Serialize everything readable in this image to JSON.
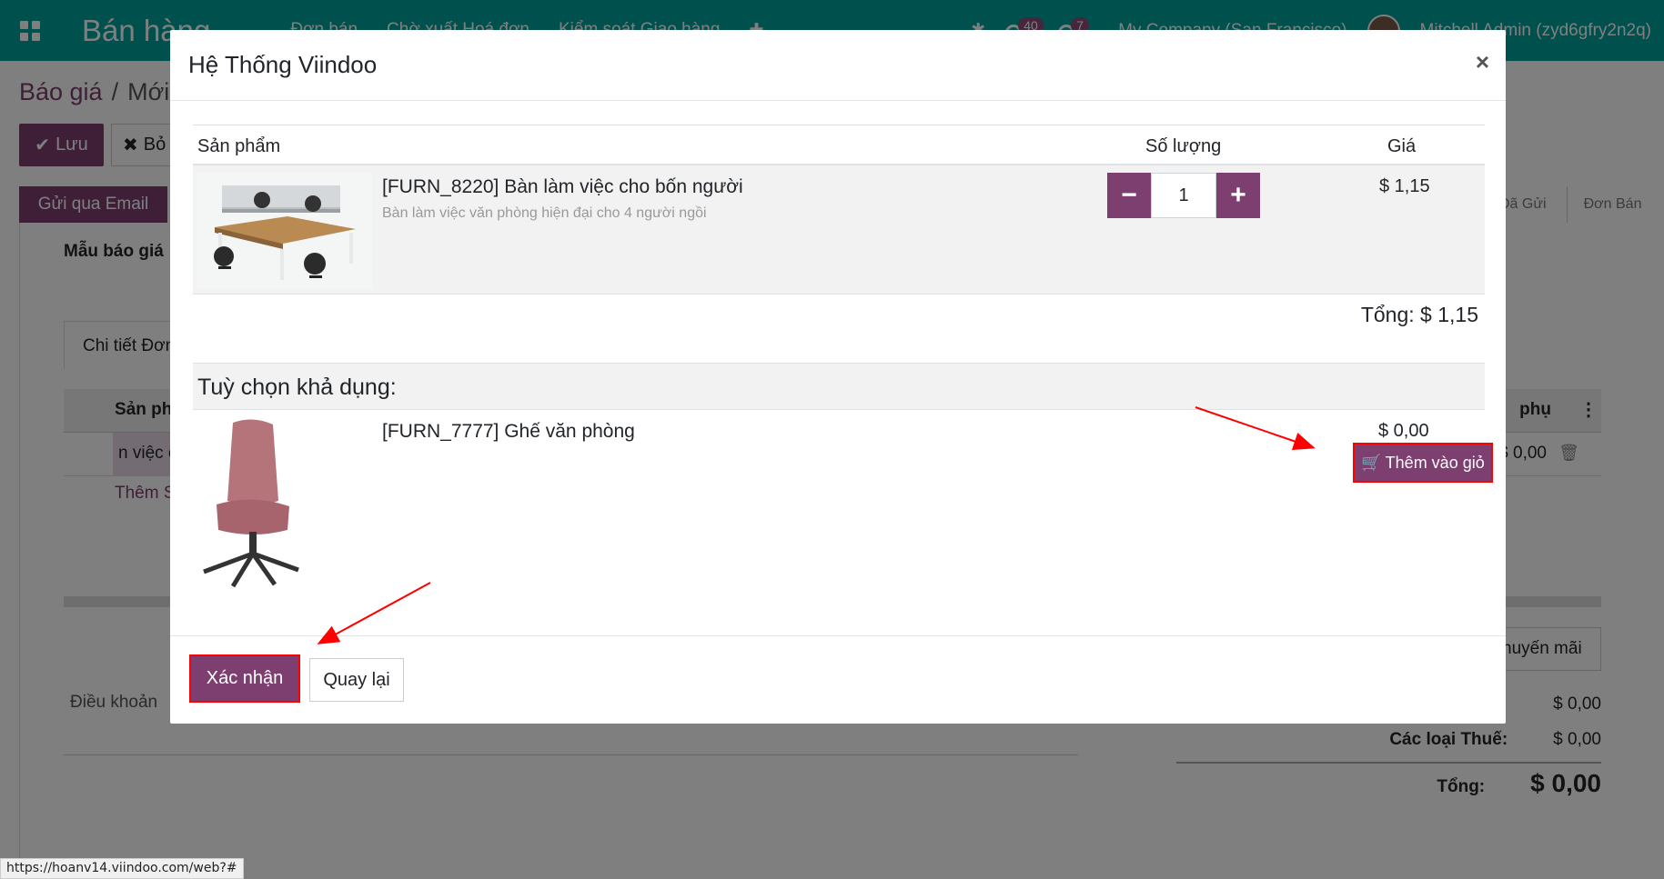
{
  "navbar": {
    "brand": "Bán hàng",
    "menu": [
      "Đơn bán",
      "Chờ xuất Hoá đơn",
      "Kiểm soát Giao hàng"
    ],
    "activity_count": "40",
    "message_count": "7",
    "company": "My Company (San Francisco)",
    "user": "Mitchell Admin (zyd6gfry2n2q)"
  },
  "page": {
    "breadcrumb_parent": "Báo giá",
    "breadcrumb_sep": "/",
    "breadcrumb_current": "Mới",
    "save_label": "Lưu",
    "discard_label": "Bỏ",
    "send_email_label": "Gửi qua Email",
    "status_steps": [
      "Đã Gửi",
      "Đơn Bán"
    ],
    "template_label": "Mẫu báo giá",
    "tab_label": "Chi tiết Đơn",
    "col_product": "Sản phẩm",
    "col_subtotal": "phụ",
    "row_product": "n việc c",
    "row_price": "$ 0,00",
    "add_product": "Thêm S",
    "promo_label": "huyến mãi",
    "terms_label": "Điều khoản",
    "untaxed_value": "$ 0,00",
    "taxes_label": "Các loại Thuế:",
    "taxes_value": "$ 0,00",
    "total_label": "Tổng:",
    "total_value": "$ 0,00"
  },
  "modal": {
    "title": "Hệ Thống Viindoo",
    "close": "×",
    "col_product": "Sản phẩm",
    "col_qty": "Số lượng",
    "col_price": "Giá",
    "product": {
      "name": "[FURN_8220] Bàn làm việc cho bốn người",
      "description": "Bàn làm việc văn phòng hiện đại cho 4 người ngồi",
      "qty": "1",
      "price": "$ 1,15"
    },
    "total": "Tổng: $ 1,15",
    "options_title": "Tuỳ chọn khả dụng:",
    "option": {
      "name": "[FURN_7777] Ghế văn phòng",
      "price": "$ 0,00",
      "add_label": "Thêm vào giỏ"
    },
    "confirm_label": "Xác nhận",
    "back_label": "Quay lại"
  },
  "status_url": "https://hoanv14.viindoo.com/web?#",
  "colors": {
    "navbar": "#00a09d",
    "primary": "#7c3f6f",
    "highlight": "#ff0000"
  }
}
